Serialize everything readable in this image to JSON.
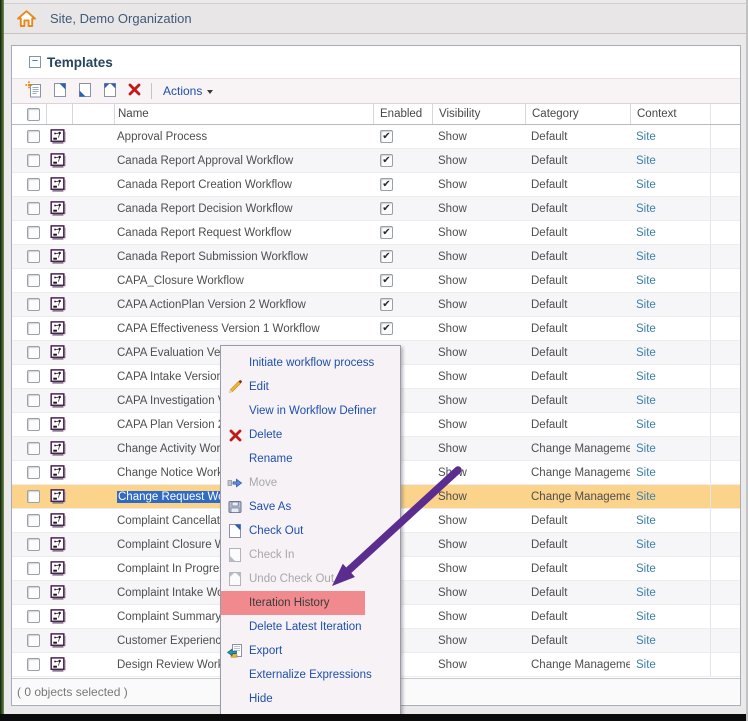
{
  "breadcrumb": {
    "title": "Site, Demo Organization"
  },
  "panel": {
    "title": "Templates",
    "collapse_glyph": "−",
    "toolbar": {
      "actions_label": "Actions",
      "buttons": [
        {
          "name": "new-template",
          "icon": "new-template-icon"
        },
        {
          "name": "check-out",
          "icon": "check-out-icon"
        },
        {
          "name": "check-in",
          "icon": "check-in-icon"
        },
        {
          "name": "undo-check-out",
          "icon": "undo-check-out-icon"
        },
        {
          "name": "delete",
          "icon": "delete-x-icon"
        }
      ]
    },
    "table": {
      "columns": [
        "Name",
        "Enabled",
        "Visibility",
        "Category",
        "Context"
      ],
      "rows": [
        {
          "name": "Approval Process",
          "enabled": true,
          "visibility": "Show",
          "category": "Default",
          "context": "Site"
        },
        {
          "name": "Canada Report Approval Workflow",
          "enabled": true,
          "visibility": "Show",
          "category": "Default",
          "context": "Site"
        },
        {
          "name": "Canada Report Creation Workflow",
          "enabled": true,
          "visibility": "Show",
          "category": "Default",
          "context": "Site"
        },
        {
          "name": "Canada Report Decision Workflow",
          "enabled": true,
          "visibility": "Show",
          "category": "Default",
          "context": "Site"
        },
        {
          "name": "Canada Report Request Workflow",
          "enabled": true,
          "visibility": "Show",
          "category": "Default",
          "context": "Site"
        },
        {
          "name": "Canada Report Submission Workflow",
          "enabled": true,
          "visibility": "Show",
          "category": "Default",
          "context": "Site"
        },
        {
          "name": "CAPA_Closure Workflow",
          "enabled": true,
          "visibility": "Show",
          "category": "Default",
          "context": "Site"
        },
        {
          "name": "CAPA ActionPlan Version 2 Workflow",
          "enabled": true,
          "visibility": "Show",
          "category": "Default",
          "context": "Site"
        },
        {
          "name": "CAPA Effectiveness Version 1 Workflow",
          "enabled": true,
          "visibility": "Show",
          "category": "Default",
          "context": "Site"
        },
        {
          "name": "CAPA Evaluation Vers",
          "enabled": true,
          "visibility": "Show",
          "category": "Default",
          "context": "Site"
        },
        {
          "name": "CAPA Intake Version",
          "enabled": true,
          "visibility": "Show",
          "category": "Default",
          "context": "Site"
        },
        {
          "name": "CAPA Investigation V",
          "enabled": true,
          "visibility": "Show",
          "category": "Default",
          "context": "Site"
        },
        {
          "name": "CAPA Plan Version 2",
          "enabled": true,
          "visibility": "Show",
          "category": "Default",
          "context": "Site"
        },
        {
          "name": "Change Activity Work",
          "enabled": true,
          "visibility": "Show",
          "category": "Change Management",
          "context": "Site"
        },
        {
          "name": "Change Notice Workf",
          "enabled": true,
          "visibility": "Show",
          "category": "Change Management",
          "context": "Site"
        },
        {
          "name": "Change Request Wor",
          "enabled": true,
          "visibility": "Show",
          "category": "Change Management",
          "context": "Site",
          "selected": true
        },
        {
          "name": "Complaint Cancellatio",
          "enabled": true,
          "visibility": "Show",
          "category": "Default",
          "context": "Site"
        },
        {
          "name": "Complaint Closure W",
          "enabled": true,
          "visibility": "Show",
          "category": "Default",
          "context": "Site"
        },
        {
          "name": "Complaint In Progres",
          "enabled": true,
          "visibility": "Show",
          "category": "Default",
          "context": "Site"
        },
        {
          "name": "Complaint Intake Wor",
          "enabled": true,
          "visibility": "Show",
          "category": "Default",
          "context": "Site"
        },
        {
          "name": "Complaint Summary A",
          "enabled": true,
          "visibility": "Show",
          "category": "Default",
          "context": "Site"
        },
        {
          "name": "Customer Experience",
          "enabled": true,
          "visibility": "Show",
          "category": "Default",
          "context": "Site"
        },
        {
          "name": "Design Review Workf",
          "enabled": true,
          "visibility": "Show",
          "category": "Change Management",
          "context": "Site"
        }
      ]
    },
    "status": "( 0 objects selected )"
  },
  "context_menu": {
    "items": [
      {
        "label": "Initiate workflow process",
        "icon": null,
        "state": "enabled"
      },
      {
        "label": "Edit",
        "icon": "pencil-icon",
        "state": "enabled"
      },
      {
        "label": "View in Workflow Definer",
        "icon": null,
        "state": "enabled"
      },
      {
        "label": "Delete",
        "icon": "delete-x-icon",
        "state": "enabled"
      },
      {
        "label": "Rename",
        "icon": null,
        "state": "enabled"
      },
      {
        "label": "Move",
        "icon": "move-icon",
        "state": "disabled"
      },
      {
        "label": "Save As",
        "icon": "save-as-icon",
        "state": "enabled"
      },
      {
        "label": "Check Out",
        "icon": "check-out-icon",
        "state": "enabled"
      },
      {
        "label": "Check In",
        "icon": "check-in-gray-icon",
        "state": "disabled"
      },
      {
        "label": "Undo Check Out",
        "icon": "undo-check-out-gray-icon",
        "state": "disabled"
      },
      {
        "label": "Iteration History",
        "icon": null,
        "state": "highlighted"
      },
      {
        "label": "Delete Latest Iteration",
        "icon": null,
        "state": "enabled"
      },
      {
        "label": "Export",
        "icon": "export-icon",
        "state": "enabled"
      },
      {
        "label": "Externalize Expressions",
        "icon": null,
        "state": "enabled"
      },
      {
        "label": "Hide",
        "icon": null,
        "state": "enabled"
      }
    ]
  },
  "annotation": {
    "type": "arrow",
    "color": "#5b2d8e",
    "highlight_color": "#f18a8e"
  },
  "colors": {
    "selected_row": "#fbd38b",
    "selection_text_bg": "#2f6bc4",
    "link": "#3d7fae",
    "menu_text": "#1d4fae",
    "accent_orange": "#e8891d",
    "panel_title": "#26445e"
  }
}
